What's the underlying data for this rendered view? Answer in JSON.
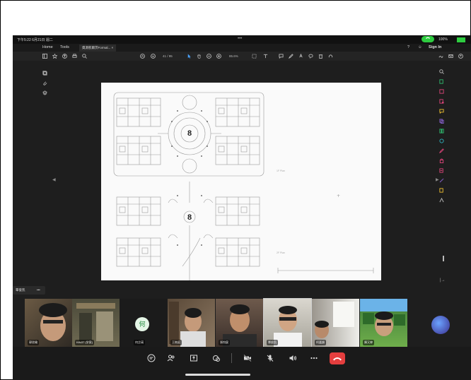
{
  "status": {
    "time": "下午5:22  6月21日 週二",
    "dots": "•••",
    "battery": "100%"
  },
  "tabs": {
    "home": "Home",
    "tools": "Tools",
    "doc_tab": "資源凱爾茨Formal... ×",
    "signin": "Sign In"
  },
  "toolbar": {
    "page": "41 / 95",
    "zoom": "85.6%"
  },
  "document": {
    "label_1f": "1F Plan",
    "label_2f": "2F Plan",
    "room_numeral": "8"
  },
  "bottom": {
    "name_chip": "覃俊凯",
    "name_chip_more": "•••",
    "participants": [
      {
        "name": "郭欣瑜"
      },
      {
        "name": "Kifu37 (学家)"
      },
      {
        "name": "何芷瑛",
        "initial": "何"
      },
      {
        "name": "王楷庭"
      },
      {
        "name": "張钧宸"
      },
      {
        "name": "覃俊凯"
      },
      {
        "name": "柯嘉穎"
      },
      {
        "name": "陳又婷"
      }
    ]
  },
  "colors": {
    "end_call": "#e43e3e",
    "call_pill": "#2ecc40",
    "rail_accent": "#e0457b"
  },
  "icons": {
    "toolbar_right": [
      "help-icon",
      "user-icon"
    ],
    "controls": [
      "chat-icon",
      "participants-icon",
      "share-icon",
      "reactions-icon",
      "camera-off-icon",
      "mic-off-icon",
      "speaker-icon",
      "more-icon",
      "end-call-icon"
    ]
  }
}
